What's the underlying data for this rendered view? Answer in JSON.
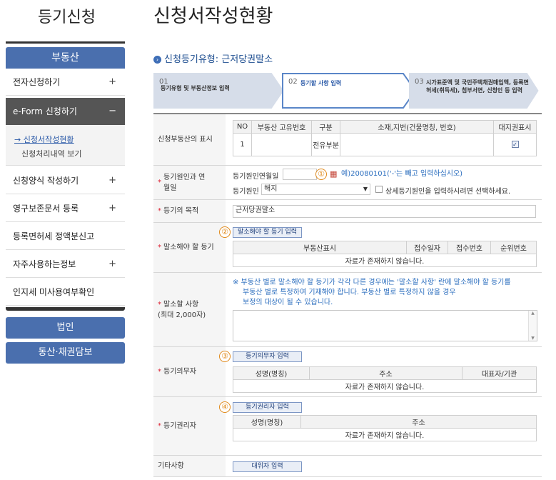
{
  "sidebar": {
    "title": "등기신청",
    "head": "부동산",
    "items": [
      {
        "label": "전자신청하기",
        "pm": "+"
      },
      {
        "label": "e-Form 신청하기",
        "pm": "−"
      },
      {
        "label": "신청양식 작성하기",
        "pm": "+"
      },
      {
        "label": "영구보존문서 등록",
        "pm": "+"
      },
      {
        "label": "등록면허세 정액분신고",
        "pm": ""
      },
      {
        "label": "자주사용하는정보",
        "pm": "+"
      },
      {
        "label": "인지세 미사용여부확인",
        "pm": ""
      }
    ],
    "sub_items": [
      "→ 신청서작성현황",
      "신청처리내역 보기"
    ],
    "bottom_buttons": [
      "법인",
      "동산·채권담보"
    ]
  },
  "main": {
    "page_title": "신청서작성현황",
    "registry_type": "신청등기유형: 근저당권말소",
    "steps": [
      {
        "num": "01",
        "label": "등기유형 및 부동산정보 입력"
      },
      {
        "num": "02",
        "label": "등기할 사항 입력"
      },
      {
        "num": "03",
        "label": "시가표준액 및 국민주택채권매입액, 등록면허세(취득세), 첨부서면, 신청인 등 입력"
      }
    ],
    "rows": {
      "property": {
        "label": "신청부동산의 표시",
        "headers": [
          "NO",
          "부동산 고유번호",
          "구분",
          "소재,지번(건물명칭, 번호)",
          "대지권표시"
        ],
        "cells": [
          "1",
          "",
          "전유부분",
          "",
          ""
        ]
      },
      "cause": {
        "label": "등기원인과 연월일",
        "date_label": "등기원인연월일",
        "date_hint": "예)20080101('-'는 빼고 입력하십시오)",
        "cause_label": "등기원인",
        "cause_value": "해지",
        "detail_checkbox": "상세등기원인을 입력하시려면 선택하세요."
      },
      "purpose": {
        "label": "등기의 목적",
        "value": "근저당권말소"
      },
      "cancel_reg": {
        "label": "말소해야 할 등기",
        "button": "말소해야 할 등기 입력",
        "headers": [
          "부동산표시",
          "접수일자",
          "접수번호",
          "순위번호"
        ],
        "empty": "자료가 존재하지 않습니다."
      },
      "cancel_item": {
        "label": "말소할 사항",
        "label2": "(최대 2,000자)",
        "note": [
          "※ 부동산 별로 말소해야 할 등기가 각각 다른 경우에는 '말소할 사항' 란에 말소해야 할 등기를",
          "부동산 별로 특정하여 기재해야 합니다. 부동산 별로 특정하지 않을 경우",
          "보정의 대상이 될 수 있습니다."
        ]
      },
      "obligor": {
        "label": "등기의무자",
        "button": "등기의무자 입력",
        "headers": [
          "성명(명칭)",
          "주소",
          "대표자/기관"
        ],
        "empty": "자료가 존재하지 않습니다."
      },
      "obligee": {
        "label": "등기권리자",
        "button": "등기권리자 입력",
        "headers": [
          "성명(명칭)",
          "주소"
        ],
        "empty": "자료가 존재하지 않습니다."
      },
      "etc": {
        "label": "기타사항",
        "button": "대위자 입력"
      }
    },
    "markers": [
      "①",
      "②",
      "③",
      "④"
    ]
  },
  "colors": {
    "brand_blue": "#4a6fae",
    "link_blue": "#2d6fbf",
    "marker_orange": "#e08a1c",
    "required_red": "#d23"
  }
}
